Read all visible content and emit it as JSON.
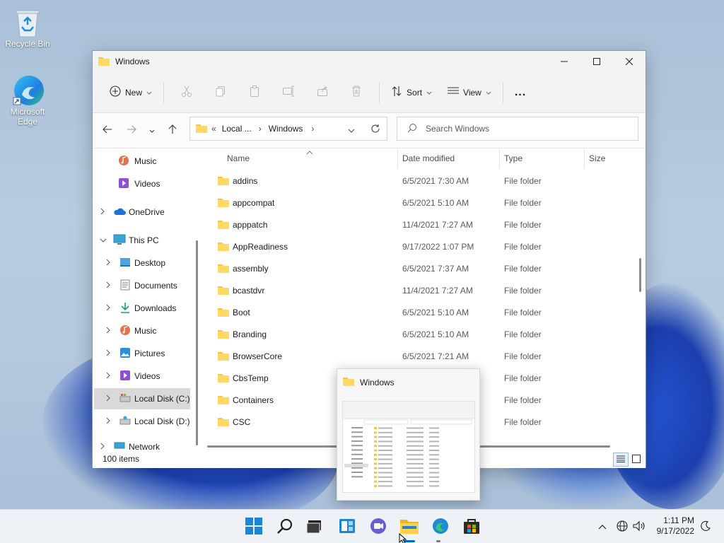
{
  "desktop": {
    "icons": [
      {
        "label": "Recycle Bin"
      },
      {
        "label": "Microsoft\nEdge"
      }
    ]
  },
  "window": {
    "title": "Windows",
    "commandbar": {
      "new_label": "New",
      "sort_label": "Sort",
      "view_label": "View",
      "more_label": "..."
    },
    "address": {
      "crumb_prefix": "«",
      "crumb_1": "Local ...",
      "crumb_sep": "›",
      "crumb_2": "Windows"
    },
    "search": {
      "placeholder": "Search Windows"
    },
    "nav": {
      "items": [
        {
          "label": "Music"
        },
        {
          "label": "Videos"
        },
        {
          "label": "OneDrive"
        },
        {
          "label": "This PC"
        },
        {
          "label": "Desktop"
        },
        {
          "label": "Documents"
        },
        {
          "label": "Downloads"
        },
        {
          "label": "Music"
        },
        {
          "label": "Pictures"
        },
        {
          "label": "Videos"
        },
        {
          "label": "Local Disk (C:)"
        },
        {
          "label": "Local Disk (D:)"
        },
        {
          "label": "Network"
        }
      ]
    },
    "columns": {
      "name": "Name",
      "date": "Date modified",
      "type": "Type",
      "size": "Size"
    },
    "rows": [
      {
        "name": "addins",
        "date": "6/5/2021 7:30 AM",
        "type": "File folder"
      },
      {
        "name": "appcompat",
        "date": "6/5/2021 5:10 AM",
        "type": "File folder"
      },
      {
        "name": "apppatch",
        "date": "11/4/2021 7:27 AM",
        "type": "File folder"
      },
      {
        "name": "AppReadiness",
        "date": "9/17/2022 1:07 PM",
        "type": "File folder"
      },
      {
        "name": "assembly",
        "date": "6/5/2021 7:37 AM",
        "type": "File folder"
      },
      {
        "name": "bcastdvr",
        "date": "11/4/2021 7:27 AM",
        "type": "File folder"
      },
      {
        "name": "Boot",
        "date": "6/5/2021 5:10 AM",
        "type": "File folder"
      },
      {
        "name": "Branding",
        "date": "6/5/2021 5:10 AM",
        "type": "File folder"
      },
      {
        "name": "BrowserCore",
        "date": "6/5/2021 7:21 AM",
        "type": "File folder"
      },
      {
        "name": "CbsTemp",
        "date": "",
        "type": "File folder"
      },
      {
        "name": "Containers",
        "date": "",
        "type": "File folder"
      },
      {
        "name": "CSC",
        "date": "",
        "type": "File folder"
      }
    ],
    "status": {
      "count": "100 items"
    }
  },
  "thumbnail": {
    "title": "Windows"
  },
  "taskbar": {
    "time": "1:11 PM",
    "date": "9/17/2022"
  },
  "colors": {
    "accent": "#0067c0",
    "folder": "#f4c542"
  }
}
